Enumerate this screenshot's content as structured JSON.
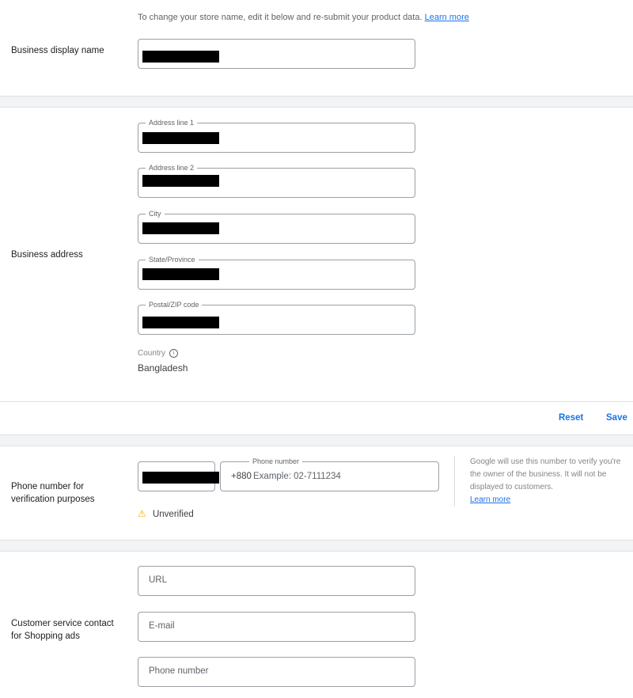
{
  "store_name": {
    "hint_text": "To change your store name, edit it below and re-submit your product data.",
    "hint_link": "Learn more",
    "label": "Business display name",
    "value": "[redacted]"
  },
  "address": {
    "label": "Business address",
    "fields": [
      {
        "legend": "Address line 1",
        "value": "[redacted]"
      },
      {
        "legend": "Address line 2",
        "value": "[redacted]"
      },
      {
        "legend": "City",
        "value": "[redacted]"
      },
      {
        "legend": "State/Province",
        "value": "[redacted]"
      },
      {
        "legend": "Postal/ZIP code",
        "value": "[redacted]"
      }
    ],
    "country_label": "Country",
    "country_value": "Bangladesh",
    "reset_label": "Reset",
    "save_label": "Save"
  },
  "phone": {
    "label_line1": "Phone number for",
    "label_line2": "verification purposes",
    "country_code_value": "[redacted]",
    "legend": "Phone number",
    "prefix": "+880",
    "placeholder": "Example: 02-7111234",
    "status": "Unverified",
    "status_color": "#f9ab00",
    "info_text": "Google will use this number to verify you're the owner of the business. It will not be displayed to customers.",
    "info_link": "Learn more"
  },
  "customer_service": {
    "label_line1": "Customer service contact",
    "label_line2": "for Shopping ads",
    "url_placeholder": "URL",
    "email_placeholder": "E-mail",
    "phone_placeholder": "Phone number"
  }
}
